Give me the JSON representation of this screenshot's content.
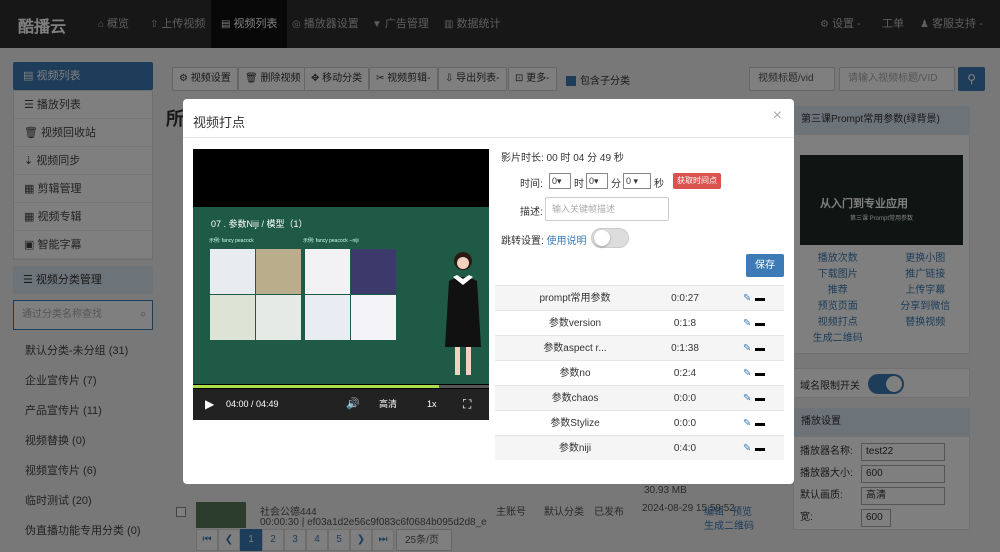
{
  "nav": {
    "brand": "酷播云",
    "items": [
      {
        "icon": "home-icon",
        "glyph": "⌂",
        "label": "概览"
      },
      {
        "icon": "upload-icon",
        "glyph": "⇧",
        "label": "上传视频"
      },
      {
        "icon": "video-list-icon",
        "glyph": "▤",
        "label": "视频列表"
      },
      {
        "icon": "player-settings-icon",
        "glyph": "◎",
        "label": "播放器设置"
      },
      {
        "icon": "ad-icon",
        "glyph": "▼",
        "label": "广告管理"
      },
      {
        "icon": "stats-icon",
        "glyph": "▥",
        "label": "数据统计"
      }
    ],
    "right": [
      {
        "icon": "gear-icon",
        "glyph": "⚙",
        "label": "设置 -"
      },
      {
        "icon": "",
        "glyph": "",
        "label": "工单"
      },
      {
        "icon": "user-icon",
        "glyph": "♟",
        "label": "客服支持 -"
      }
    ]
  },
  "sidebar": {
    "title": "视频列表",
    "items": [
      "播放列表",
      "视频回收站",
      "视频同步",
      "剪辑管理",
      "视频专辑",
      "智能字幕"
    ],
    "cat_title": "视频分类管理",
    "search_placeholder": "通过分类名称查找",
    "categories": [
      "默认分类-未分组 (31)",
      "企业宣传片 (7)",
      "产品宣传片 (11)",
      "视频替换 (0)",
      "视频宣传片 (6)",
      "临时测试 (20)",
      "伪直播功能专用分类 (0)"
    ]
  },
  "toolbar": {
    "buttons": [
      "视频设置",
      "删除视频",
      "移动分类",
      "视频剪辑-",
      "导出列表-",
      "更多-"
    ],
    "include_sub": "包含子分类",
    "select_label": "视频标题/vid",
    "search_placeholder": "请输入视频标题/VID"
  },
  "background": {
    "title_char": "所",
    "row1": {
      "title": "社会公德444",
      "meta": "00:00:30 | ef03a1d2e56c9f083c6f0684b095d2d8_e",
      "owner": "主账号",
      "cat": "默认分类",
      "status": "已发布",
      "date": "2024-08-29 15:59:52",
      "size": "30.93 MB",
      "actions": [
        "编辑",
        "预览",
        "生成二维码"
      ]
    }
  },
  "pager": {
    "pages": [
      "1",
      "2",
      "3",
      "4",
      "5"
    ],
    "active": "1",
    "page_size": "25条/页"
  },
  "right_panel": {
    "title": "第三课Prompt常用参数(绿背景)",
    "thumb_text": "从入门到专业应用",
    "thumb_sub": "第三课 Prompt常用参数",
    "links": [
      "播放次数",
      "更换小图",
      "下载图片",
      "推广链接",
      "推荐",
      "上传字幕",
      "预览页面",
      "分享到微信",
      "视频打点",
      "替换视频",
      "生成二维码"
    ],
    "domain_limit_label": "域名限制开关",
    "play_settings": "播放设置",
    "fields": [
      {
        "label": "播放器名称:",
        "value": "test22"
      },
      {
        "label": "播放器大小:",
        "value": "600"
      },
      {
        "label": "默认画质:",
        "value": "高清"
      },
      {
        "label": "宽:",
        "value": "600"
      }
    ]
  },
  "modal": {
    "title": "视频打点",
    "duration": "影片时长: 00 时 04 分 49 秒",
    "time_label": "时间:",
    "h": "0",
    "h_unit": "时",
    "m": "0",
    "m_unit": "分",
    "s": "0",
    "s_unit": "秒",
    "get_time": "获取时间点",
    "desc_label": "描述:",
    "desc_placeholder": "输入关键帧描述",
    "jump_label": "跳转设置:",
    "jump_link": "使用说明",
    "save": "保存",
    "video": {
      "slide_title": "07 . 参数Niji / 模型（1）",
      "slide_left": "示例: fancy peacock",
      "slide_right": "示例: fancy peacock --niji",
      "time": "04:00 / 04:49",
      "quality": "高清",
      "speed": "1x",
      "progress": 0.83
    },
    "marks": [
      {
        "name": "prompt常用参数",
        "time": "0:0:27"
      },
      {
        "name": "参数version",
        "time": "0:1:8"
      },
      {
        "name": "参数aspect r...",
        "time": "0:1:38"
      },
      {
        "name": "参数no",
        "time": "0:2:4"
      },
      {
        "name": "参数chaos",
        "time": "0:0:0"
      },
      {
        "name": "参数Stylize",
        "time": "0:0:0"
      },
      {
        "name": "参数niji",
        "time": "0:4:0"
      }
    ]
  }
}
